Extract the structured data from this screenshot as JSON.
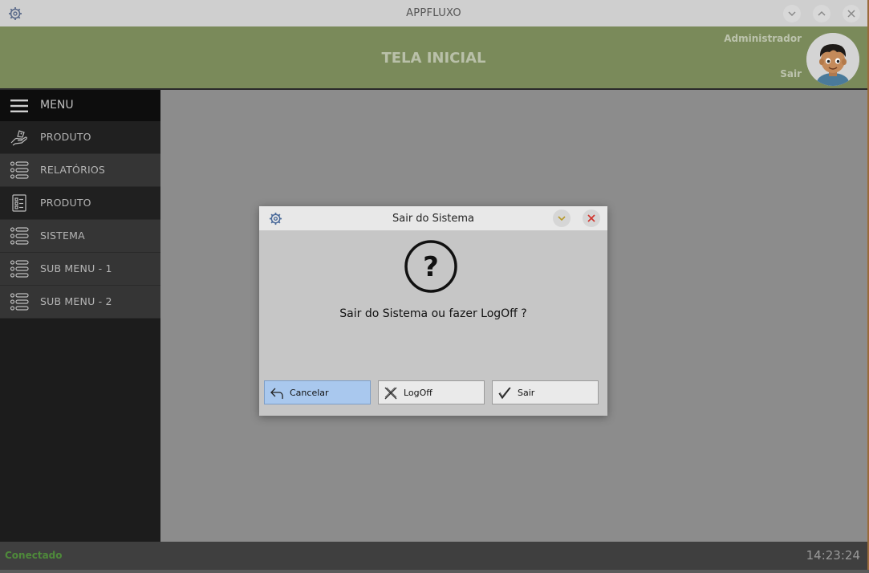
{
  "window": {
    "title": "APPFLUXO"
  },
  "header": {
    "page_title": "TELA INICIAL",
    "user_name": "Administrador",
    "logout_link": "Sair"
  },
  "sidebar": {
    "menu_label": "MENU",
    "items": [
      {
        "label": "PRODUTO",
        "icon": "hand-icon"
      },
      {
        "label": "RELATÓRIOS",
        "icon": "list-icon"
      },
      {
        "label": "PRODUTO",
        "icon": "checklist-icon"
      },
      {
        "label": "SISTEMA",
        "icon": "list-icon"
      },
      {
        "label": "SUB MENU - 1",
        "icon": "list-icon"
      },
      {
        "label": "SUB MENU - 2",
        "icon": "list-icon"
      }
    ]
  },
  "status": {
    "connection": "Conectado",
    "clock": "14:23:24",
    "connection_color": "#4e8a3a"
  },
  "dialog": {
    "title": "Sair do Sistema",
    "message": "Sair do Sistema ou fazer LogOff ?",
    "buttons": {
      "cancel": "Cancelar",
      "logoff": "LogOff",
      "exit": "Sair"
    },
    "primary_button_color": "#a9c8ee"
  },
  "colors": {
    "header_bg": "#7a8a5a",
    "sidebar_bg": "#1c1c1c",
    "content_bg": "#8c8c8c"
  }
}
